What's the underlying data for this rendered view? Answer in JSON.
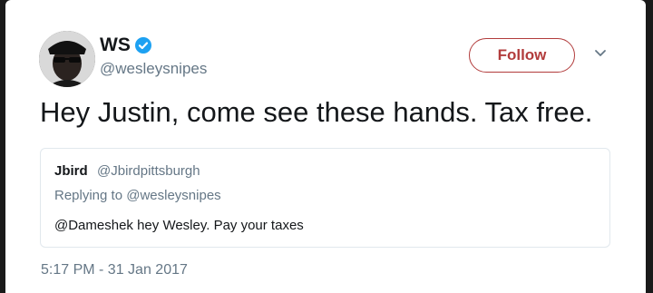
{
  "tweet": {
    "display_name": "WS",
    "handle": "@wesleysnipes",
    "follow_label": "Follow",
    "text": "Hey Justin, come see these hands. Tax free.",
    "timestamp": "5:17 PM - 31 Jan 2017"
  },
  "quoted": {
    "display_name": "Jbird",
    "handle": "@Jbirdpittsburgh",
    "replying_prefix": "Replying to",
    "replying_to": "@wesleysnipes",
    "text": "@Dameshek hey Wesley. Pay your taxes"
  },
  "colors": {
    "follow_accent": "#b23c3c",
    "verified_badge": "#1da1f2",
    "secondary_text": "#657786"
  },
  "icons": {
    "verified": "verified-badge-icon",
    "caret": "chevron-down-icon"
  }
}
